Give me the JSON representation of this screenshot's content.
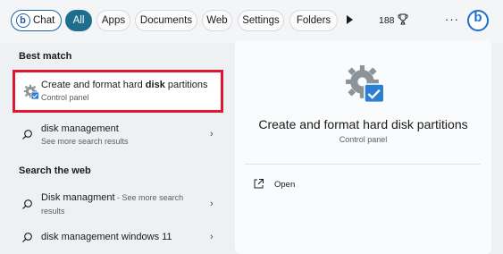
{
  "filters": {
    "chat": "Chat",
    "all": "All",
    "apps": "Apps",
    "documents": "Documents",
    "web": "Web",
    "settings": "Settings",
    "folders": "Folders",
    "rewards_count": "188",
    "more": "···"
  },
  "results": {
    "best_match_heading": "Best match",
    "best_match": {
      "title_before": "Create and format hard ",
      "title_bold": "disk",
      "title_after": " partitions",
      "subtitle": "Control panel",
      "icon": "disk-partition-settings-icon"
    },
    "disk_management": {
      "title": "disk management",
      "subtitle": "See more search results"
    },
    "web_heading": "Search the web",
    "web_items": [
      {
        "title": "Disk managment",
        "inline": " - See more search",
        "subtitle": "results"
      },
      {
        "title": "disk management windows 11"
      }
    ]
  },
  "preview": {
    "title": "Create and format hard disk partitions",
    "subtitle": "Control panel",
    "open_label": "Open"
  },
  "colors": {
    "highlight_border": "#e0182f",
    "accent": "#1e6f8e",
    "bing": "#1f6fd1"
  }
}
